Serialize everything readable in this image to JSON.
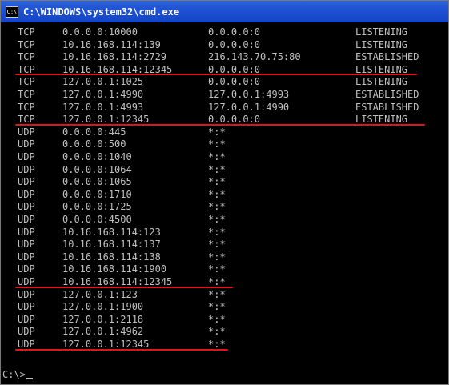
{
  "window": {
    "title": "C:\\WINDOWS\\system32\\cmd.exe",
    "icon_label": "C:\\"
  },
  "console": {
    "rows": [
      {
        "proto": "TCP",
        "local": "0.0.0.0:10000",
        "foreign": "0.0.0.0:0",
        "state": "LISTENING"
      },
      {
        "proto": "TCP",
        "local": "10.16.168.114:139",
        "foreign": "0.0.0.0:0",
        "state": "LISTENING"
      },
      {
        "proto": "TCP",
        "local": "10.16.168.114:2729",
        "foreign": "216.143.70.75:80",
        "state": "ESTABLISHED"
      },
      {
        "proto": "TCP",
        "local": "10.16.168.114:12345",
        "foreign": "0.0.0.0:0",
        "state": "LISTENING"
      },
      {
        "proto": "TCP",
        "local": "127.0.0.1:1025",
        "foreign": "0.0.0.0:0",
        "state": "LISTENING"
      },
      {
        "proto": "TCP",
        "local": "127.0.0.1:4990",
        "foreign": "127.0.0.1:4993",
        "state": "ESTABLISHED"
      },
      {
        "proto": "TCP",
        "local": "127.0.0.1:4993",
        "foreign": "127.0.0.1:4990",
        "state": "ESTABLISHED"
      },
      {
        "proto": "TCP",
        "local": "127.0.0.1:12345",
        "foreign": "0.0.0.0:0",
        "state": "LISTENING"
      },
      {
        "proto": "UDP",
        "local": "0.0.0.0:445",
        "foreign": "*:*",
        "state": ""
      },
      {
        "proto": "UDP",
        "local": "0.0.0.0:500",
        "foreign": "*:*",
        "state": ""
      },
      {
        "proto": "UDP",
        "local": "0.0.0.0:1040",
        "foreign": "*:*",
        "state": ""
      },
      {
        "proto": "UDP",
        "local": "0.0.0.0:1064",
        "foreign": "*:*",
        "state": ""
      },
      {
        "proto": "UDP",
        "local": "0.0.0.0:1065",
        "foreign": "*:*",
        "state": ""
      },
      {
        "proto": "UDP",
        "local": "0.0.0.0:1710",
        "foreign": "*:*",
        "state": ""
      },
      {
        "proto": "UDP",
        "local": "0.0.0.0:1725",
        "foreign": "*:*",
        "state": ""
      },
      {
        "proto": "UDP",
        "local": "0.0.0.0:4500",
        "foreign": "*:*",
        "state": ""
      },
      {
        "proto": "UDP",
        "local": "10.16.168.114:123",
        "foreign": "*:*",
        "state": ""
      },
      {
        "proto": "UDP",
        "local": "10.16.168.114:137",
        "foreign": "*:*",
        "state": ""
      },
      {
        "proto": "UDP",
        "local": "10.16.168.114:138",
        "foreign": "*:*",
        "state": ""
      },
      {
        "proto": "UDP",
        "local": "10.16.168.114:1900",
        "foreign": "*:*",
        "state": ""
      },
      {
        "proto": "UDP",
        "local": "10.16.168.114:12345",
        "foreign": "*:*",
        "state": ""
      },
      {
        "proto": "UDP",
        "local": "127.0.0.1:123",
        "foreign": "*:*",
        "state": ""
      },
      {
        "proto": "UDP",
        "local": "127.0.0.1:1900",
        "foreign": "*:*",
        "state": ""
      },
      {
        "proto": "UDP",
        "local": "127.0.0.1:2118",
        "foreign": "*:*",
        "state": ""
      },
      {
        "proto": "UDP",
        "local": "127.0.0.1:4962",
        "foreign": "*:*",
        "state": ""
      },
      {
        "proto": "UDP",
        "local": "127.0.0.1:12345",
        "foreign": "*:*",
        "state": ""
      }
    ],
    "prompt": "C:\\>"
  },
  "colors": {
    "background": "#000000",
    "text": "#c0c0c0",
    "titlebar": "#1d50d3",
    "annotation": "#e0141a"
  }
}
